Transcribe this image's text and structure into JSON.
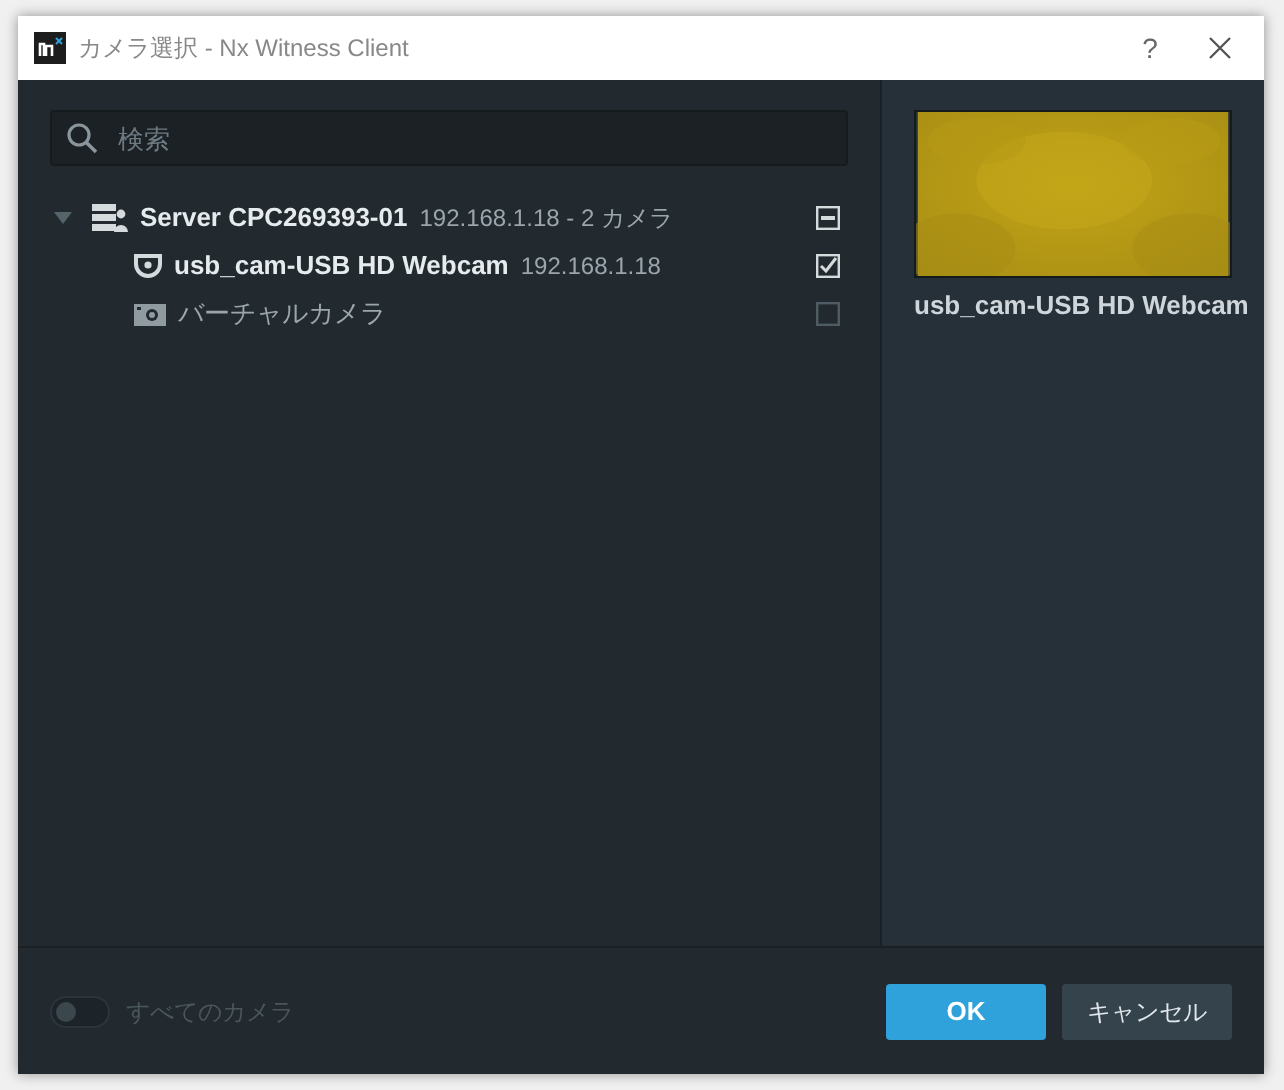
{
  "window": {
    "title": "カメラ選択 - Nx Witness Client",
    "help": "?"
  },
  "search": {
    "placeholder": "検索"
  },
  "tree": [
    {
      "kind": "server",
      "name": "Server CPC269393-01",
      "detail": "192.168.1.18 - 2 カメラ",
      "expanded": true,
      "checked": true,
      "partial": true,
      "children": [
        {
          "kind": "camera",
          "name": "usb_cam-USB HD Webcam",
          "detail": "192.168.1.18",
          "checked": true
        },
        {
          "kind": "virtual",
          "name": "バーチャルカメラ",
          "checked": false
        }
      ]
    }
  ],
  "preview": {
    "caption": "usb_cam-USB HD Webcam"
  },
  "footer": {
    "all_cameras": {
      "label": "すべてのカメラ",
      "on": false
    },
    "buttons": [
      {
        "label": "OK",
        "kind": "primary"
      },
      {
        "label": "キャンセル",
        "kind": "secondary"
      }
    ]
  }
}
